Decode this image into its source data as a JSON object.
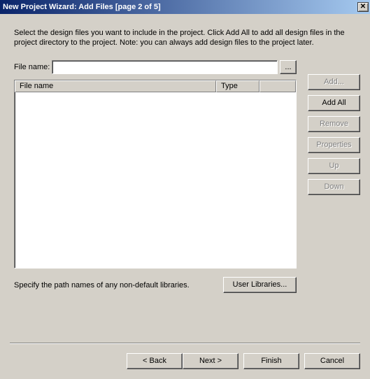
{
  "title": "New Project Wizard: Add Files [page 2 of 5]",
  "intro": "Select the design files you want to include in the project. Click Add All to add all design files in the project directory to the project. Note: you can always add design files to the project later.",
  "filename_label": "File name:",
  "filename_value": "",
  "browse_label": "...",
  "columns": {
    "filename": "File name",
    "type": "Type"
  },
  "buttons": {
    "add": "Add...",
    "add_all": "Add All",
    "remove": "Remove",
    "properties": "Properties",
    "up": "Up",
    "down": "Down"
  },
  "libs_text": "Specify the path names of any non-default libraries.",
  "user_libraries": "User Libraries...",
  "nav": {
    "back": "< Back",
    "next": "Next >",
    "finish": "Finish",
    "cancel": "Cancel"
  }
}
